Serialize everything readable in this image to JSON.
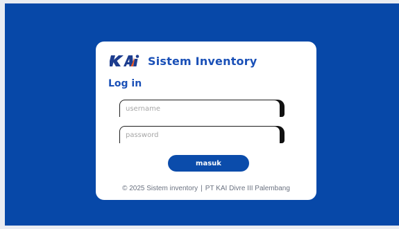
{
  "app": {
    "logo_text": "KAI",
    "title": "Sistem Inventory"
  },
  "login": {
    "heading": "Log in",
    "username_placeholder": "username",
    "username_value": "",
    "password_placeholder": "password",
    "password_value": "",
    "submit_label": "masuk"
  },
  "footer": {
    "copyright": "© 2025 Sistem inventory",
    "separator": "|",
    "organization": "PT KAI Divre III Palembang"
  },
  "colors": {
    "background": "#0748a8",
    "brand_blue": "#1a50b7",
    "button": "#0b4cab",
    "logo_accent": "#f15a22"
  },
  "icons": {
    "logo": "kai-logo-icon"
  }
}
